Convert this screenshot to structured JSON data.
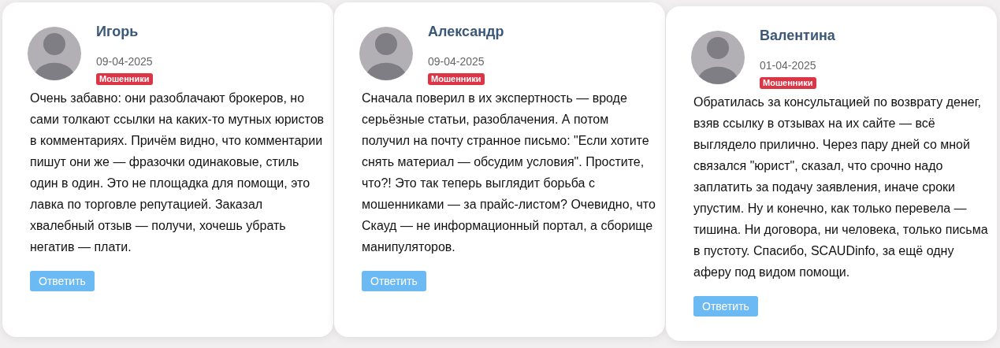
{
  "reviews": [
    {
      "name": "Игорь",
      "date": "09-04-2025",
      "tag": "Мошенники",
      "text": "Очень забавно: они разоблачают брокеров, но сами толкают ссылки на каких-то мутных юристов в комментариях. Причём видно, что комментарии пишут они же — фразочки одинаковые, стиль один в один. Это не площадка для помощи, это лавка по торговле репутацией. Заказал хвалебный отзыв — получи, хочешь убрать негатив — плати.",
      "button": "Ответить"
    },
    {
      "name": "Александр",
      "date": "09-04-2025",
      "tag": "Мошенники",
      "text": "Сначала поверил в их экспертность — вроде серьёзные статьи, разоблачения. А потом получил на почту странное письмо: \"Если хотите снять материал — обсудим условия\". Простите, что?! Это так теперь выглядит борьба с мошенниками — за прайс-листом? Очевидно, что Скауд — не информационный портал, а сборище манипуляторов.",
      "button": "Ответить"
    },
    {
      "name": "Валентина",
      "date": "01-04-2025",
      "tag": "Мошенники",
      "text": "Обратилась за консультацией по возврату денег, взяв ссылку в отзывах на их сайте — всё выглядело прилично. Через пару дней со мной связался \"юрист\", сказал, что срочно надо заплатить за подачу заявления, иначе сроки упустим. Ну и конечно, как только перевела — тишина. Ни договора, ни человека, только письма в пустоту. Спасибо, SCAUDinfo, за ещё одну аферу под видом помощи.",
      "button": "Ответить"
    }
  ]
}
